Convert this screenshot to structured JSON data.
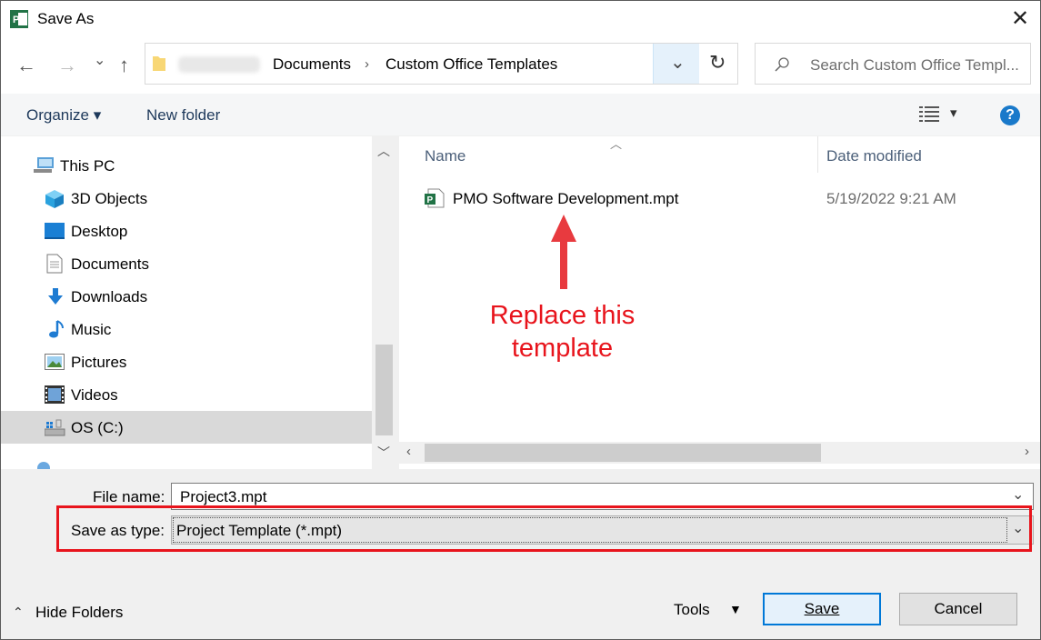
{
  "window": {
    "title": "Save As",
    "close": "✕"
  },
  "nav": {
    "back": "←",
    "forward": "→",
    "recent": "⌄",
    "up": "↑",
    "breadcrumb": [
      "Documents",
      "Custom Office Templates"
    ],
    "dropdown": "⌄",
    "refresh": "↻"
  },
  "search": {
    "placeholder": "Search Custom Office Templ..."
  },
  "toolbar": {
    "organize": "Organize ▾",
    "new_folder": "New folder",
    "view_dd": "▾",
    "help": "?"
  },
  "sidebar": {
    "items": [
      {
        "label": "This PC",
        "icon": "pc-icon"
      },
      {
        "label": "3D Objects",
        "icon": "3d-objects-icon"
      },
      {
        "label": "Desktop",
        "icon": "desktop-icon"
      },
      {
        "label": "Documents",
        "icon": "documents-icon"
      },
      {
        "label": "Downloads",
        "icon": "downloads-icon"
      },
      {
        "label": "Music",
        "icon": "music-icon"
      },
      {
        "label": "Pictures",
        "icon": "pictures-icon"
      },
      {
        "label": "Videos",
        "icon": "videos-icon"
      },
      {
        "label": "OS (C:)",
        "icon": "drive-icon",
        "selected": true
      }
    ]
  },
  "files": {
    "columns": {
      "name": "Name",
      "date": "Date modified"
    },
    "rows": [
      {
        "name": "PMO Software Development.mpt",
        "date": "5/19/2022 9:21 AM"
      }
    ]
  },
  "annotation": {
    "line1": "Replace this",
    "line2": "template"
  },
  "form": {
    "file_name_label": "File name:",
    "file_name_value": "Project3.mpt",
    "type_label": "Save as type:",
    "type_value": "Project Template (*.mpt)"
  },
  "footer": {
    "hide_folders": "Hide Folders",
    "tools": "Tools",
    "save": "Save",
    "cancel": "Cancel"
  },
  "colors": {
    "accent": "#0078d7",
    "annotation": "#e8141c",
    "project_green": "#217346"
  }
}
